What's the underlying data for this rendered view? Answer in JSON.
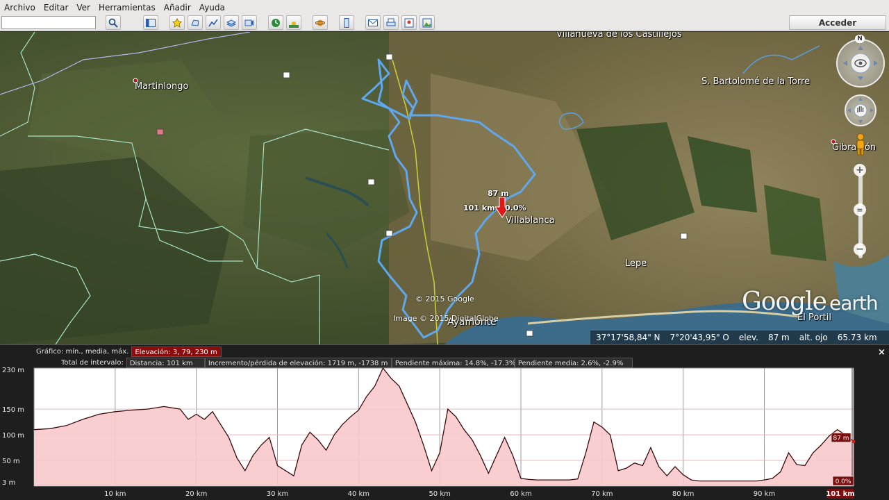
{
  "menu": [
    "Archivo",
    "Editar",
    "Ver",
    "Herramientas",
    "Añadir",
    "Ayuda"
  ],
  "toolbar": {
    "search_value": "",
    "login_label": "Acceder",
    "buttons": [
      "search-icon",
      "sidebar-toggle-icon",
      "placemark-icon",
      "polygon-icon",
      "path-icon",
      "overlay-icon",
      "tour-icon",
      "historical-imagery-icon",
      "sunlight-icon",
      "planet-icon",
      "ruler-icon",
      "email-icon",
      "print-icon",
      "maps-icon",
      "save-image-icon"
    ]
  },
  "map": {
    "places": {
      "villanueva": "Villanueva de los Castillejos",
      "martinlongo": "Martinlongo",
      "bartolome": "S. Bartolomé de la Torre",
      "gibraleon": "Gibraleón",
      "villablanca": "Villablanca",
      "lepe": "Lepe",
      "ayamonte": "Ayamonte",
      "portil": "El Portil"
    },
    "marker": {
      "elevation": "87 m",
      "distance": "101 km",
      "slope": "0.0%"
    },
    "copyright": [
      "© 2015 Google",
      "Image © 2015 DigitalGlobe"
    ],
    "logo": {
      "google": "Google",
      "earth": "earth"
    },
    "status": {
      "lat": "37°17'58,84\" N",
      "lon": "7°20'43,95\" O",
      "elev_label": "elev.",
      "elev_value": "87 m",
      "eye_label": "alt. ojo",
      "eye_value": "65.73 km"
    },
    "compass_north": "N",
    "zoom_in": "+",
    "zoom_out": "−",
    "route_color": "#5fa8ee"
  },
  "elevation_panel": {
    "graph_label": "Gráfico: mín., media, máx.",
    "graph_value": "Elevación: 3, 79, 230 m",
    "total_label": "Total de intervalo:",
    "distance": "Distancia: 101 km",
    "gain_loss": "Incremento/pérdida de elevación: 1719 m, -1738 m",
    "max_slope": "Pendiente máxima: 14.8%, -17.3%",
    "avg_slope": "Pendiente media: 2.6%, -2.9%",
    "close": "×",
    "current_elevation": "87 m",
    "current_slope": "0.0%",
    "current_distance": "101 km"
  },
  "chart_data": {
    "type": "area",
    "xlabel": "",
    "ylabel": "",
    "xlim": [
      0,
      101
    ],
    "ylim": [
      0,
      230
    ],
    "x_ticks": [
      10,
      20,
      30,
      40,
      50,
      60,
      70,
      80,
      90
    ],
    "x_tick_labels": [
      "10 km",
      "20 km",
      "30 km",
      "40 km",
      "50 km",
      "60 km",
      "70 km",
      "80 km",
      "90 km"
    ],
    "y_ticks": [
      3,
      50,
      100,
      150,
      230
    ],
    "y_tick_labels": [
      "3 m",
      "50 m",
      "100 m",
      "150 m",
      "230 m"
    ],
    "fill_color": "#f7c9cc",
    "line_color": "#3a0a0a",
    "x": [
      0,
      2,
      4,
      6,
      8,
      10,
      12,
      14,
      16,
      18,
      19,
      20,
      21,
      22,
      23,
      24,
      25,
      26,
      27,
      28,
      29,
      30,
      31,
      32,
      33,
      34,
      35,
      36,
      37,
      38,
      39,
      40,
      41,
      42,
      43,
      44,
      45,
      46,
      47,
      48,
      49,
      50,
      51,
      52,
      53,
      54,
      55,
      56,
      57,
      58,
      59,
      60,
      61,
      62,
      63,
      64,
      65,
      66,
      67,
      68,
      69,
      70,
      71,
      72,
      73,
      74,
      75,
      76,
      77,
      78,
      79,
      80,
      81,
      82,
      83,
      84,
      85,
      86,
      87,
      88,
      89,
      90,
      91,
      92,
      93,
      94,
      95,
      96,
      97,
      98,
      99,
      100,
      101
    ],
    "y": [
      110,
      112,
      118,
      130,
      140,
      145,
      148,
      150,
      155,
      150,
      130,
      140,
      130,
      145,
      120,
      95,
      55,
      30,
      60,
      80,
      95,
      40,
      30,
      20,
      80,
      105,
      90,
      70,
      100,
      120,
      135,
      148,
      175,
      195,
      230,
      210,
      195,
      160,
      125,
      80,
      30,
      65,
      150,
      135,
      110,
      90,
      60,
      25,
      60,
      95,
      60,
      15,
      13,
      12,
      12,
      12,
      12,
      12,
      14,
      65,
      125,
      115,
      100,
      30,
      35,
      45,
      40,
      75,
      38,
      20,
      38,
      22,
      12,
      10,
      10,
      10,
      10,
      10,
      10,
      10,
      10,
      12,
      15,
      28,
      65,
      42,
      40,
      65,
      80,
      98,
      110,
      100,
      87
    ]
  }
}
